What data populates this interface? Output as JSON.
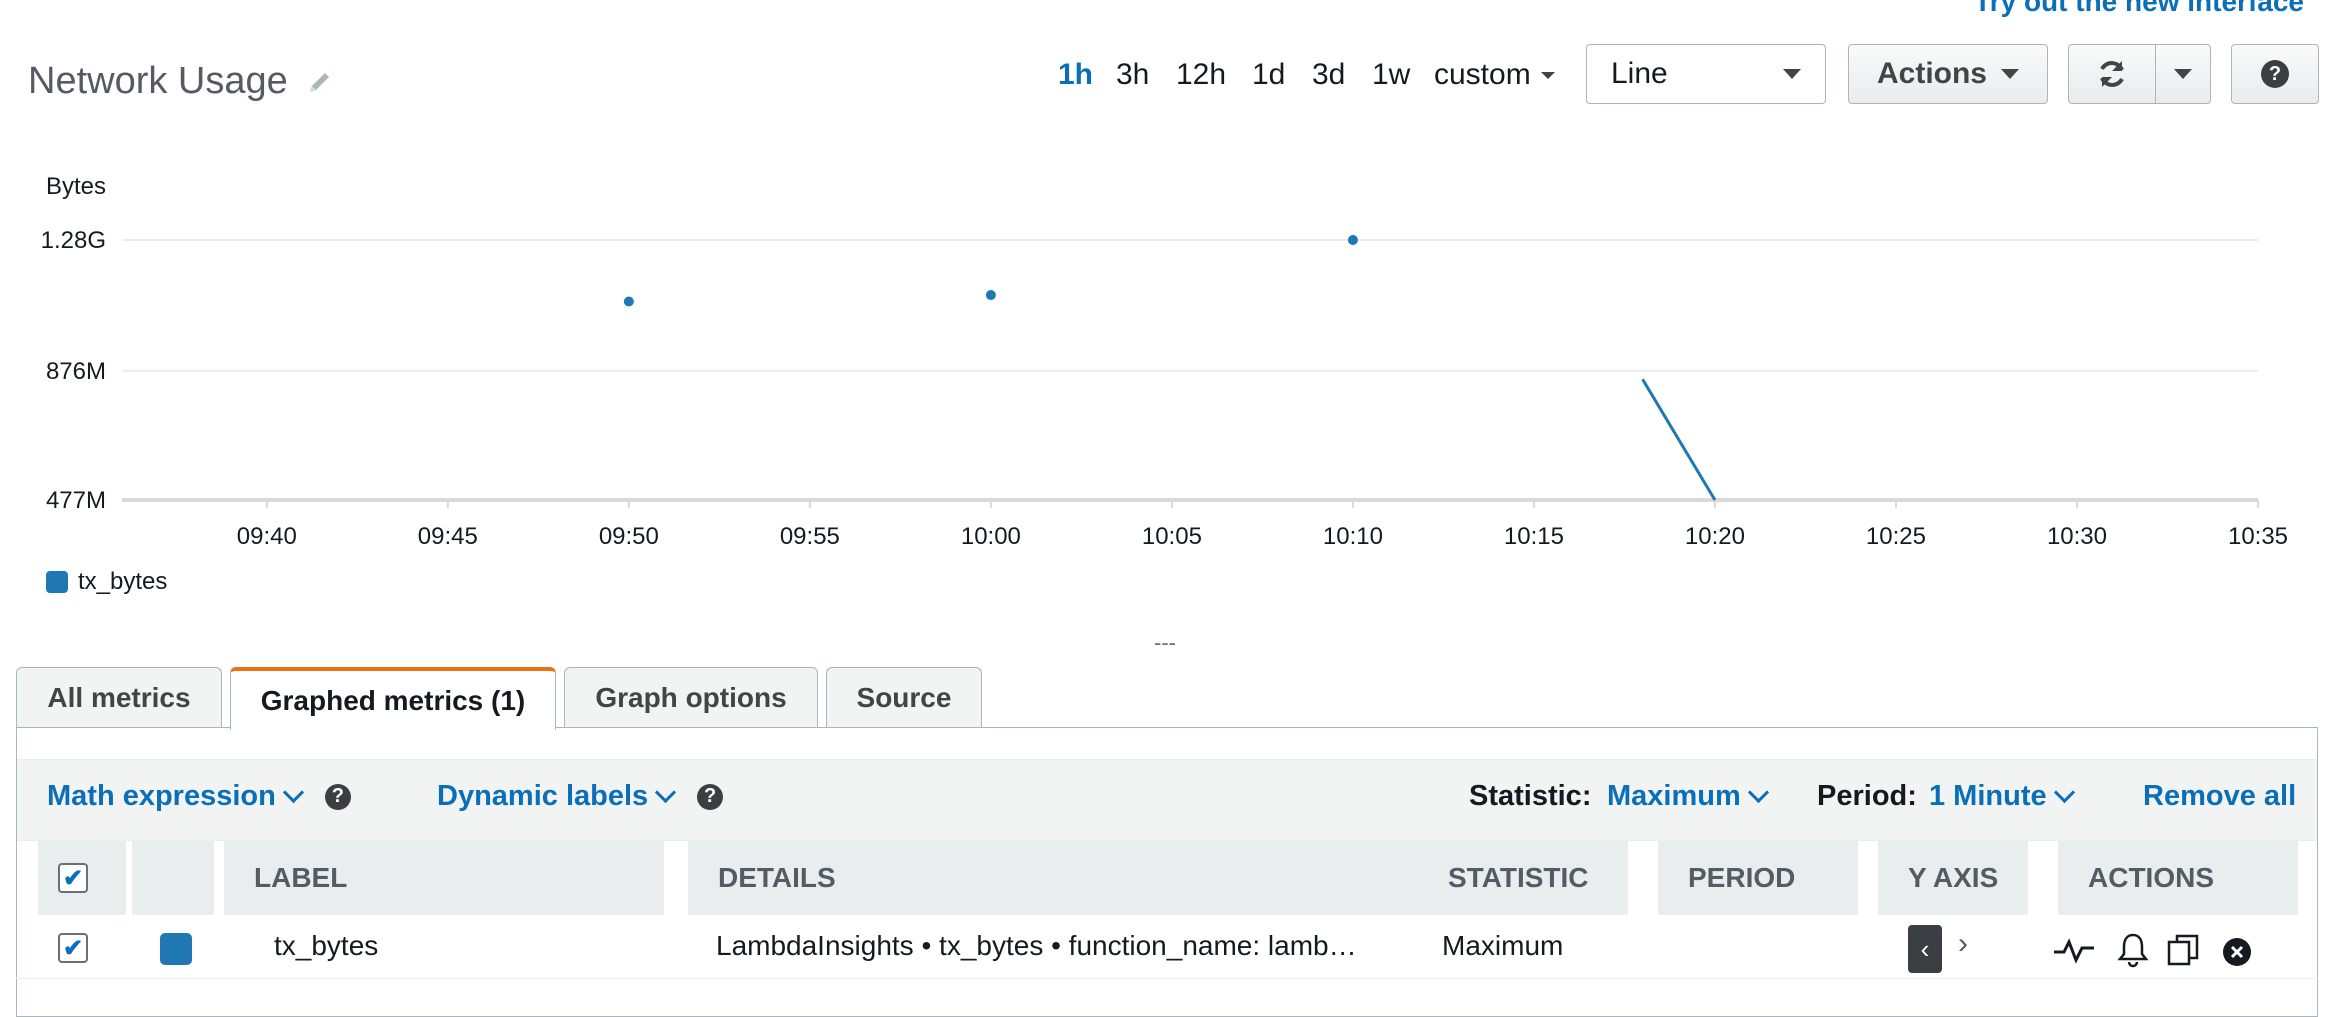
{
  "header": {
    "top_link": "Try out the new interface",
    "title": "Network Usage",
    "time_ranges": [
      "1h",
      "3h",
      "12h",
      "1d",
      "3d",
      "1w",
      "custom"
    ],
    "active_range": "1h",
    "view_type": "Line",
    "actions_label": "Actions",
    "help_symbol": "?"
  },
  "chart_data": {
    "type": "line",
    "ylabel": "Bytes",
    "y_ticks": [
      "477M",
      "876M",
      "1.28G"
    ],
    "y_tick_values": [
      477,
      876,
      1280
    ],
    "ylim": [
      477,
      1280
    ],
    "x_ticks": [
      "09:40",
      "09:45",
      "09:50",
      "09:55",
      "10:00",
      "10:05",
      "10:10",
      "10:15",
      "10:20",
      "10:25",
      "10:30",
      "10:35"
    ],
    "xlim": [
      "09:36",
      "10:35"
    ],
    "series": [
      {
        "name": "tx_bytes",
        "color": "#1f77b4",
        "points": [
          {
            "x": "09:50",
            "y": 1090
          },
          {
            "x": "10:00",
            "y": 1110
          },
          {
            "x": "10:10",
            "y": 1280
          },
          {
            "x": "10:18",
            "y": 850
          },
          {
            "x": "10:20",
            "y": 477
          }
        ]
      }
    ],
    "legend": "bottom-left",
    "grid": true
  },
  "resize_handle": "---",
  "tabs": [
    {
      "label": "All metrics"
    },
    {
      "label": "Graphed metrics (1)"
    },
    {
      "label": "Graph options"
    },
    {
      "label": "Source"
    }
  ],
  "toolbar": {
    "math_expression": "Math expression",
    "dynamic_labels": "Dynamic labels",
    "statistic_label": "Statistic:",
    "statistic_value": "Maximum",
    "period_label": "Period:",
    "period_value": "1 Minute",
    "remove_all": "Remove all"
  },
  "table": {
    "columns": [
      "LABEL",
      "DETAILS",
      "STATISTIC",
      "PERIOD",
      "Y AXIS",
      "ACTIONS"
    ],
    "rows": [
      {
        "label": "tx_bytes",
        "color": "#1f77b4",
        "details": "LambdaInsights • tx_bytes • function_name: lamb…",
        "statistic": "Maximum",
        "period": ""
      }
    ]
  }
}
